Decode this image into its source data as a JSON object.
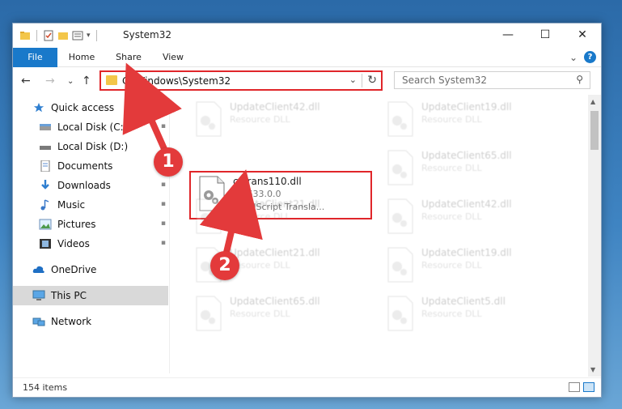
{
  "window": {
    "title": "System32",
    "controls": {
      "minimize": "—",
      "maximize": "☐",
      "close": "✕"
    }
  },
  "ribbon": {
    "tabs": [
      "File",
      "Home",
      "Share",
      "View"
    ],
    "expand_icon": "⌄",
    "help": "?"
  },
  "navigation": {
    "back": "←",
    "forward": "→",
    "recent": "⌄",
    "up": "↑",
    "address": "C:\\Windows\\System32",
    "address_dropdown": "⌄",
    "refresh": "↻",
    "search_placeholder": "Search System32",
    "search_icon": "⚲"
  },
  "sidebar": {
    "items": [
      {
        "label": "Quick access",
        "icon": "star-icon",
        "pinned": false
      },
      {
        "label": "Local Disk (C:)",
        "icon": "drive-icon",
        "pinned": true
      },
      {
        "label": "Local Disk (D:)",
        "icon": "drive-icon",
        "pinned": false
      },
      {
        "label": "Documents",
        "icon": "documents-icon",
        "pinned": true
      },
      {
        "label": "Downloads",
        "icon": "downloads-icon",
        "pinned": true
      },
      {
        "label": "Music",
        "icon": "music-icon",
        "pinned": true
      },
      {
        "label": "Pictures",
        "icon": "pictures-icon",
        "pinned": true
      },
      {
        "label": "Videos",
        "icon": "videos-icon",
        "pinned": true
      },
      {
        "label": "OneDrive",
        "icon": "cloud-icon",
        "pinned": false
      },
      {
        "label": "This PC",
        "icon": "pc-icon",
        "pinned": false
      },
      {
        "label": "Network",
        "icon": "network-icon",
        "pinned": false
      }
    ],
    "pin_glyph": "📌"
  },
  "files": {
    "left_column": [
      {
        "name": "UpdateClient42.dll",
        "type": "Resource DLL"
      },
      {
        "name": "cstrans110.dll",
        "version": "11.633.0.0",
        "description": "CorelScript Transla..."
      },
      {
        "name": "UpdateClient21.dll",
        "type": "Resource DLL"
      },
      {
        "name": "UpdateClient21.dll",
        "type": "Resource DLL"
      },
      {
        "name": "UpdateClient65.dll",
        "type": "Resource DLL"
      }
    ],
    "right_column": [
      {
        "name": "UpdateClient19.dll",
        "type": "Resource DLL"
      },
      {
        "name": "UpdateClient65.dll",
        "type": "Resource DLL"
      },
      {
        "name": "UpdateClient42.dll",
        "type": "Resource DLL"
      },
      {
        "name": "UpdateClient19.dll",
        "type": "Resource DLL"
      },
      {
        "name": "UpdateClient5.dll",
        "type": "Resource DLL"
      }
    ]
  },
  "status": {
    "item_count": "154 items"
  },
  "annotations": {
    "step1": "1",
    "step2": "2",
    "color": "#e33a3b"
  },
  "colors": {
    "accent": "#1979ca",
    "highlight_border": "#e0262a"
  }
}
